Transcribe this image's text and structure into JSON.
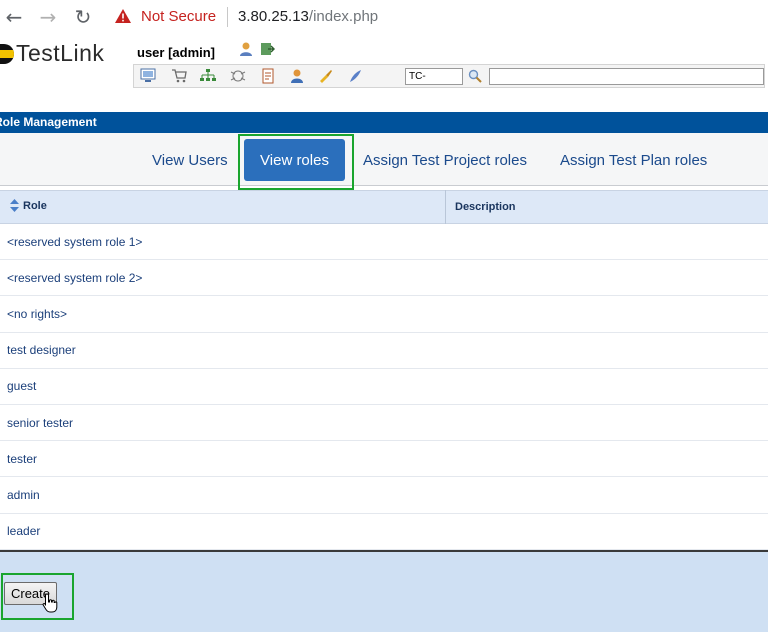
{
  "browser": {
    "not_secure": "Not Secure",
    "url_host": "3.80.25.13",
    "url_path": "/index.php"
  },
  "app": {
    "logo_text": "TestLink",
    "user_label": "user [admin]"
  },
  "toolbar": {
    "tc_prefix": "TC-",
    "icons": [
      "desktop-icon",
      "cart-icon",
      "tree-icon",
      "bug-icon",
      "document-icon",
      "user-icon",
      "brush-icon",
      "feather-icon"
    ]
  },
  "section": {
    "title": "Role Management"
  },
  "tabs": {
    "view_users": "View Users",
    "view_roles": "View roles",
    "assign_project": "Assign Test Project roles",
    "assign_plan": "Assign Test Plan roles"
  },
  "table": {
    "col_role": "Role",
    "col_description": "Description",
    "rows": [
      "<reserved system role 1>",
      "<reserved system role 2>",
      "<no rights>",
      "test designer",
      "guest",
      "senior tester",
      "tester",
      "admin",
      "leader"
    ]
  },
  "footer": {
    "create_label": "Create"
  },
  "colors": {
    "section_bar": "#00529b",
    "active_tab": "#2b6fbc",
    "highlight": "#1aa52e",
    "link": "#1b4a8c"
  }
}
